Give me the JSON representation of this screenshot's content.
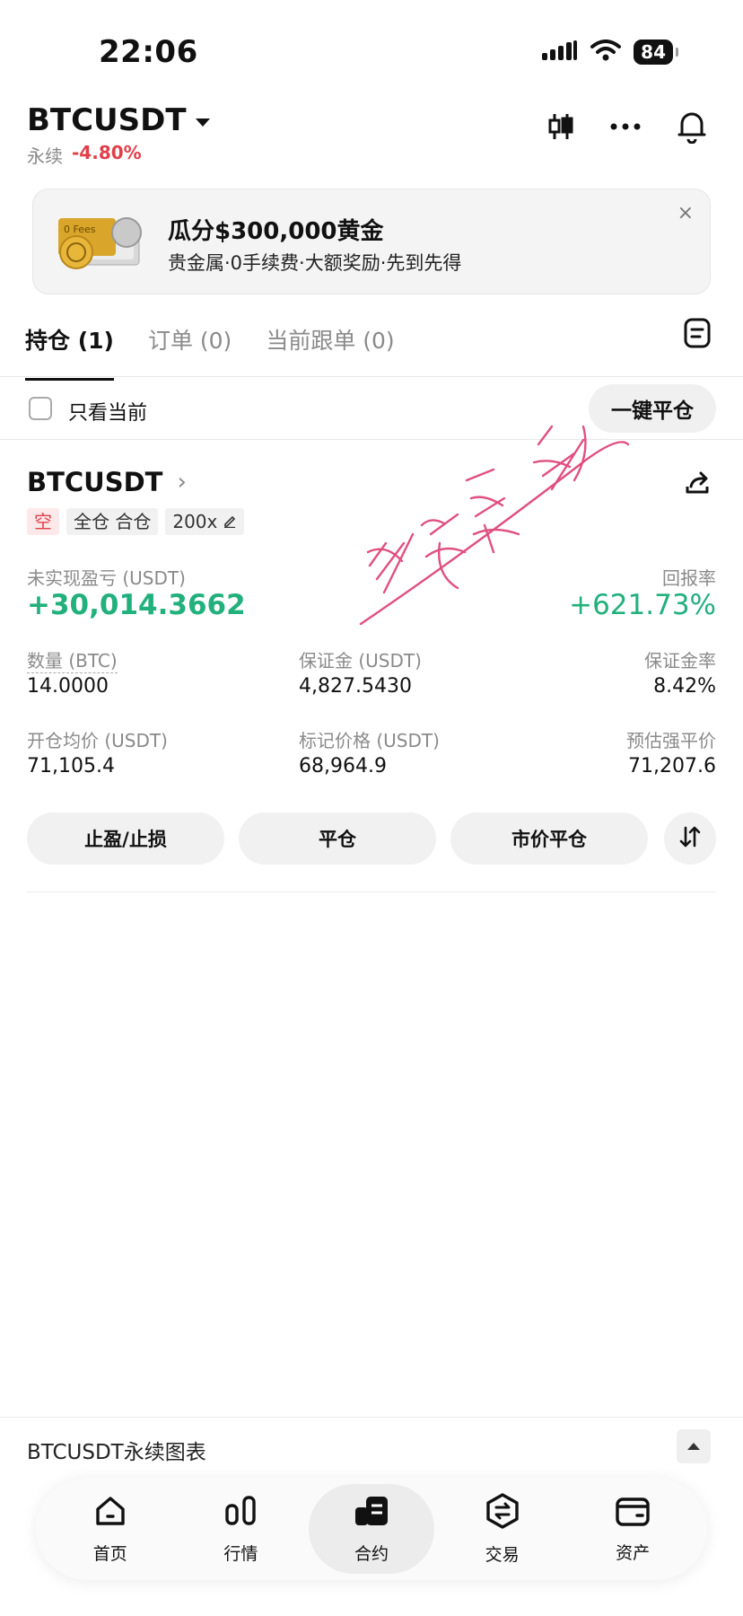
{
  "status_bar": {
    "time": "22:06",
    "battery": "84"
  },
  "header": {
    "symbol": "BTCUSDT",
    "contract_type": "永续",
    "change": "-4.80%"
  },
  "banner": {
    "title": "瓜分$300,000黄金",
    "subtitle": "贵金属·0手续费·大额奖励·先到先得",
    "image_text": "0 Fees",
    "close": "×"
  },
  "tabs": [
    {
      "label": "持仓 (1)",
      "active": true
    },
    {
      "label": "订单 (0)",
      "active": false
    },
    {
      "label": "当前跟单 (0)",
      "active": false
    }
  ],
  "filter": {
    "only_current": "只看当前",
    "close_all": "一键平仓"
  },
  "position": {
    "symbol": "BTCUSDT",
    "tags": {
      "side": "空",
      "margin_mode": "全仓 合仓",
      "leverage": "200x"
    },
    "pnl_label": "未实现盈亏 (USDT)",
    "pnl_value": "+30,014.3662",
    "roe_label": "回报率",
    "roe_value": "+621.73%",
    "qty_label": "数量 (BTC)",
    "qty_value": "14.0000",
    "margin_label": "保证金 (USDT)",
    "margin_value": "4,827.5430",
    "margin_ratio_label": "保证金率",
    "margin_ratio_value": "8.42%",
    "entry_label": "开仓均价 (USDT)",
    "entry_value": "71,105.4",
    "mark_label": "标记价格 (USDT)",
    "mark_value": "68,964.9",
    "liq_label": "预估强平价",
    "liq_value": "71,207.6",
    "buttons": {
      "tp_sl": "止盈/止损",
      "close": "平仓",
      "market_close": "市价平仓"
    }
  },
  "handwriting": {
    "text": "币安盈利",
    "color": "#e0507f"
  },
  "chart_bar": {
    "label": "BTCUSDT永续图表"
  },
  "bottom_nav": [
    {
      "label": "首页",
      "icon": "home-icon",
      "active": false
    },
    {
      "label": "行情",
      "icon": "markets-icon",
      "active": false
    },
    {
      "label": "合约",
      "icon": "futures-icon",
      "active": true
    },
    {
      "label": "交易",
      "icon": "trade-icon",
      "active": false
    },
    {
      "label": "资产",
      "icon": "wallet-icon",
      "active": false
    }
  ]
}
